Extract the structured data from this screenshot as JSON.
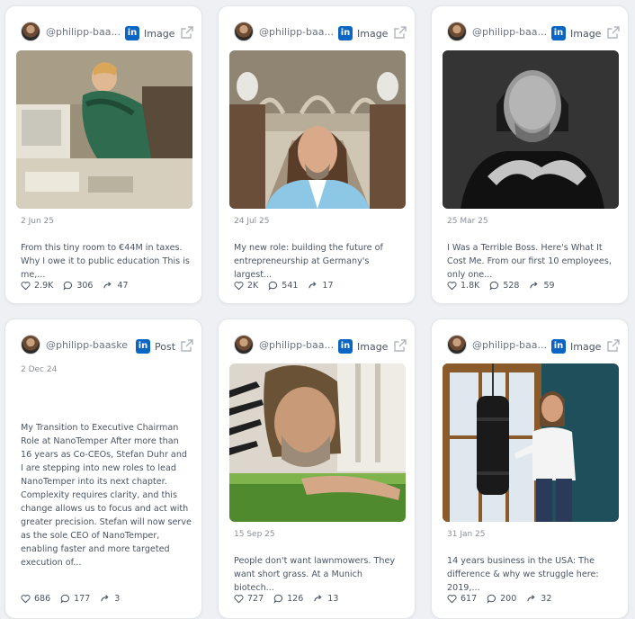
{
  "colors": {
    "linkedin": "#0a66c2",
    "card_bg": "#ffffff",
    "page_bg": "#eef0f3"
  },
  "icons": {
    "platform": "linkedin-icon",
    "external": "external-link-icon",
    "likes": "heart-icon",
    "comments": "comment-icon",
    "reposts": "repost-icon"
  },
  "linkedin_letters": "in",
  "cards": [
    {
      "author": "@philipp-baa...",
      "type": "Image",
      "image": "child-at-computer-photo",
      "date": "2 Jun 25",
      "excerpt": "From this tiny room to €44M in taxes. Why I owe it to public education This is me,...",
      "likes": "2.9K",
      "comments": "306",
      "reposts": "47"
    },
    {
      "author": "@philipp-baa...",
      "type": "Image",
      "image": "selfie-in-hall-photo",
      "date": "24 Jul 25",
      "excerpt": "My new role: building the future of entrepreneurship at Germany's largest...",
      "likes": "2K",
      "comments": "541",
      "reposts": "17"
    },
    {
      "author": "@philipp-baa...",
      "type": "Image",
      "image": "bw-portrait-photo",
      "date": "25 Mar 25",
      "excerpt": "I Was a Terrible Boss. Here's What It Cost Me. From our first 10 employees, only one...",
      "likes": "1.8K",
      "comments": "528",
      "reposts": "59"
    },
    {
      "author": "@philipp-baaske",
      "type": "Post",
      "image": "",
      "date": "2 Dec 24",
      "excerpt": "My Transition to Executive Chairman Role at NanoTemper After more than 16 years as Co-CEOs, Stefan Duhr and I are stepping into new roles to lead NanoTemper into its next chapter. Complexity requires clarity, and this change allows us to focus and act with greater precision. Stefan will now serve as the sole CEO of NanoTemper, enabling faster and more targeted execution of...",
      "likes": "686",
      "comments": "177",
      "reposts": "3"
    },
    {
      "author": "@philipp-baa...",
      "type": "Image",
      "image": "lying-on-grass-photo",
      "date": "15 Sep 25",
      "excerpt": "People don't want lawnmowers. They want short grass. At a Munich biotech...",
      "likes": "727",
      "comments": "126",
      "reposts": "13"
    },
    {
      "author": "@philipp-baa...",
      "type": "Image",
      "image": "punching-bag-photo",
      "date": "31 Jan 25",
      "excerpt": "14 years business in the USA: The difference & why we struggle here: 2019,...",
      "likes": "617",
      "comments": "200",
      "reposts": "32"
    }
  ]
}
